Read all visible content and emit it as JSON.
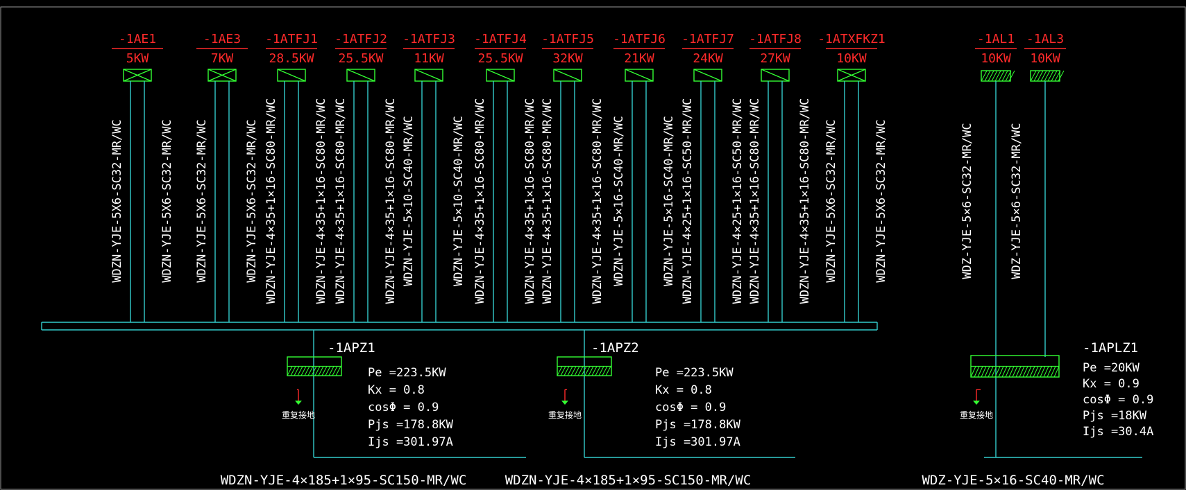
{
  "colors": {
    "background": "#000000",
    "red": "#ff2a2a",
    "green": "#33ff33",
    "cyan": "#33cccc",
    "white": "#ffffff",
    "frame": "#9a9a9a"
  },
  "feeders": [
    {
      "id": "-1AE1",
      "power": "5KW",
      "cable": "WDZN-YJE-5X6-SC32-MR/WC",
      "symbol": "x"
    },
    {
      "id": "-1AE3",
      "power": "7KW",
      "cable": "WDZN-YJE-5X6-SC32-MR/WC",
      "symbol": "x"
    },
    {
      "id": "-1ATFJ1",
      "power": "28.5KW",
      "cable": "WDZN-YJE-4×35+1×16-SC80-MR/WC",
      "symbol": "s"
    },
    {
      "id": "-1ATFJ2",
      "power": "25.5KW",
      "cable": "WDZN-YJE-4×35+1×16-SC80-MR/WC",
      "symbol": "s"
    },
    {
      "id": "-1ATFJ3",
      "power": "11KW",
      "cable": "WDZN-YJE-5×10-SC40-MR/WC",
      "symbol": "s"
    },
    {
      "id": "-1ATFJ4",
      "power": "25.5KW",
      "cable": "WDZN-YJE-4×35+1×16-SC80-MR/WC",
      "symbol": "s"
    },
    {
      "id": "-1ATFJ5",
      "power": "32KW",
      "cable": "WDZN-YJE-4×35+1×16-SC80-MR/WC",
      "symbol": "s"
    },
    {
      "id": "-1ATFJ6",
      "power": "21KW",
      "cable": "WDZN-YJE-5×16-SC40-MR/WC",
      "symbol": "s"
    },
    {
      "id": "-1ATFJ7",
      "power": "24KW",
      "cable": "WDZN-YJE-4×25+1×16-SC50-MR/WC",
      "symbol": "s"
    },
    {
      "id": "-1ATFJ8",
      "power": "27KW",
      "cable": "WDZN-YJE-4×35+1×16-SC80-MR/WC",
      "symbol": "s"
    },
    {
      "id": "-1ATXFKZ1",
      "power": "10KW",
      "cable": "WDZN-YJE-5X6-SC32-MR/WC",
      "symbol": "x"
    }
  ],
  "feeder_cables_pair": {
    "group": [
      {
        "a": "WDZN-YJE-5X6-SC32-MR/WC",
        "b": "WDZN-YJE-5X6-SC32-MR/WC"
      },
      {
        "a": "WDZN-YJE-5X6-SC32-MR/WC",
        "b": "WDZN-YJE-5X6-SC32-MR/WC"
      },
      {
        "a": "WDZN-YJE-4×35+1×16-SC80-MR/WC",
        "b": "WDZN-YJE-4×35+1×16-SC80-MR/WC"
      },
      {
        "a": "WDZN-YJE-4×35+1×16-SC80-MR/WC",
        "b": "WDZN-YJE-4×35+1×16-SC80-MR/WC"
      },
      {
        "a": "WDZN-YJE-5×10-SC40-MR/WC",
        "b": "WDZN-YJE-5×10-SC40-MR/WC"
      },
      {
        "a": "WDZN-YJE-4×35+1×16-SC80-MR/WC",
        "b": "WDZN-YJE-4×35+1×16-SC80-MR/WC"
      },
      {
        "a": "WDZN-YJE-4×35+1×16-SC80-MR/WC",
        "b": "WDZN-YJE-4×35+1×16-SC80-MR/WC"
      },
      {
        "a": "WDZN-YJE-5×16-SC40-MR/WC",
        "b": "WDZN-YJE-5×16-SC40-MR/WC"
      },
      {
        "a": "WDZN-YJE-4×25+1×16-SC50-MR/WC",
        "b": "WDZN-YJE-4×25+1×16-SC50-MR/WC"
      },
      {
        "a": "WDZN-YJE-4×35+1×16-SC80-MR/WC",
        "b": "WDZN-YJE-4×35+1×16-SC80-MR/WC"
      },
      {
        "a": "WDZN-YJE-5X6-SC32-MR/WC",
        "b": "WDZN-YJE-5X6-SC32-MR/WC"
      }
    ]
  },
  "lighting_feeders": [
    {
      "id": "-1AL1",
      "power": "10KW",
      "cable": "WDZ-YJE-5×6-SC32-MR/WC"
    },
    {
      "id": "-1AL3",
      "power": "10KW",
      "cable": "WDZ-YJE-5×6-SC32-MR/WC"
    }
  ],
  "panels": [
    {
      "id": "-1APZ1",
      "pe": "Pe =223.5KW",
      "kx": "Kx = 0.8",
      "cos": "cosΦ = 0.9",
      "pjs": "Pjs =178.8KW",
      "ijs": "Ijs =301.97A",
      "ground": "重复接地",
      "incoming": "WDZN-YJE-4×185+1×95-SC150-MR/WC"
    },
    {
      "id": "-1APZ2",
      "pe": "Pe =223.5KW",
      "kx": "Kx = 0.8",
      "cos": "cosΦ = 0.9",
      "pjs": "Pjs =178.8KW",
      "ijs": "Ijs =301.97A",
      "ground": "重复接地",
      "incoming": "WDZN-YJE-4×185+1×95-SC150-MR/WC"
    },
    {
      "id": "-1APLZ1",
      "pe": "Pe =20KW",
      "kx": "Kx = 0.9",
      "cos": "cosΦ = 0.9",
      "pjs": "Pjs =18KW",
      "ijs": "Ijs =30.4A",
      "ground": "重复接地",
      "incoming": "WDZ-YJE-5×16-SC40-MR/WC"
    }
  ]
}
